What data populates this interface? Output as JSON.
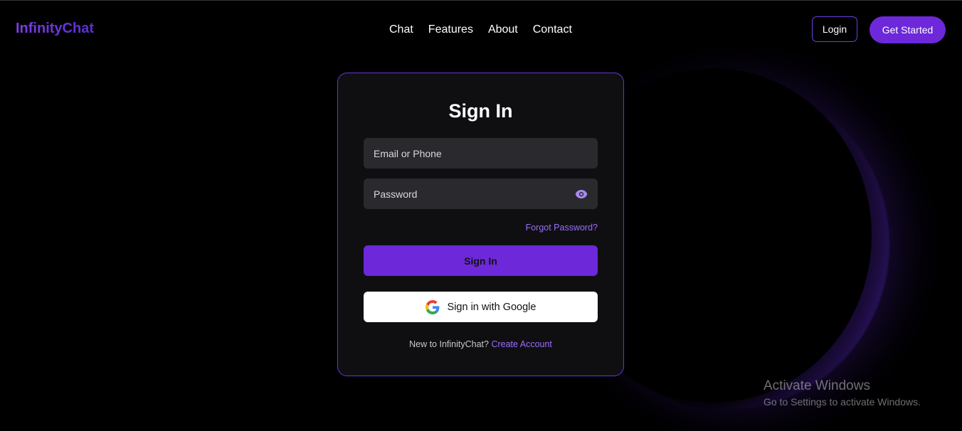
{
  "header": {
    "logo": "InfinityChat",
    "nav": [
      "Chat",
      "Features",
      "About",
      "Contact"
    ],
    "login_label": "Login",
    "get_started_label": "Get Started"
  },
  "signin": {
    "title": "Sign In",
    "email_placeholder": "Email or Phone",
    "password_placeholder": "Password",
    "forgot_label": "Forgot Password?",
    "signin_button": "Sign In",
    "google_button": "Sign in with Google",
    "new_user_text": "New to InfinityChat?",
    "create_account_label": "Create Account"
  },
  "watermark": {
    "title": "Activate Windows",
    "subtitle": "Go to Settings to activate Windows."
  },
  "colors": {
    "accent": "#6d28d9",
    "link": "#9d6bff",
    "card_border": "#6a34d8"
  }
}
